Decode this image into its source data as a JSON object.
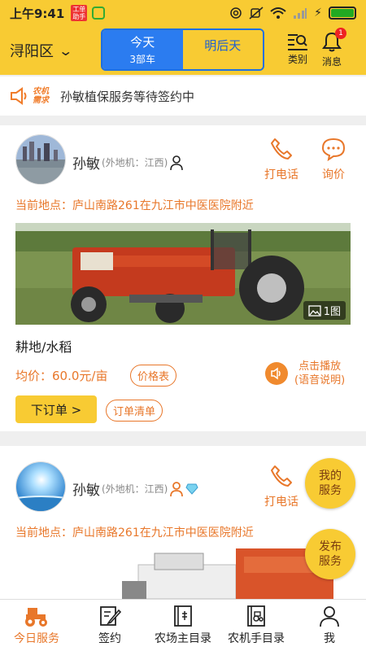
{
  "status_bar": {
    "time": "上午9:41",
    "app_badge": "工单助手"
  },
  "header": {
    "district": "浔阳区",
    "tabs": [
      {
        "label": "今天",
        "sub": "3部车"
      },
      {
        "label": "明后天"
      }
    ],
    "category_label": "类别",
    "message_label": "消息",
    "message_count": "1"
  },
  "notice": {
    "tag_line1": "农机",
    "tag_line2": "需求",
    "text": "孙敏植保服务等待签约中"
  },
  "cards": [
    {
      "name": "孙敏",
      "origin": "(外地机：江西)",
      "call_label": "打电话",
      "ask_label": "询价",
      "location": "当前地点：庐山南路261在九江市中医医院附近",
      "image_count": "1图",
      "service": "耕地/水稻",
      "price": "均价：60.0元/亩",
      "price_list_label": "价格表",
      "play_label_1": "点击播放",
      "play_label_2": "(语音说明)",
      "order_label": "下订单 >",
      "order_list_label": "订单清单"
    },
    {
      "name": "孙敏",
      "origin": "(外地机：江西)",
      "call_label": "打电话",
      "location": "当前地点：庐山南路261在九江市中医医院附近"
    }
  ],
  "fabs": {
    "my_service": "我的服务",
    "publish_service": "发布服务"
  },
  "bottom_nav": [
    {
      "label": "今日服务",
      "icon": "tractor-icon"
    },
    {
      "label": "签约",
      "icon": "edit-icon"
    },
    {
      "label": "农场主目录",
      "icon": "book-icon"
    },
    {
      "label": "农机手目录",
      "icon": "machine-book-icon"
    },
    {
      "label": "我",
      "icon": "person-icon"
    }
  ],
  "colors": {
    "brand_yellow": "#f8cb33",
    "accent_orange": "#e8772a",
    "tab_blue": "#2b7cf0"
  }
}
